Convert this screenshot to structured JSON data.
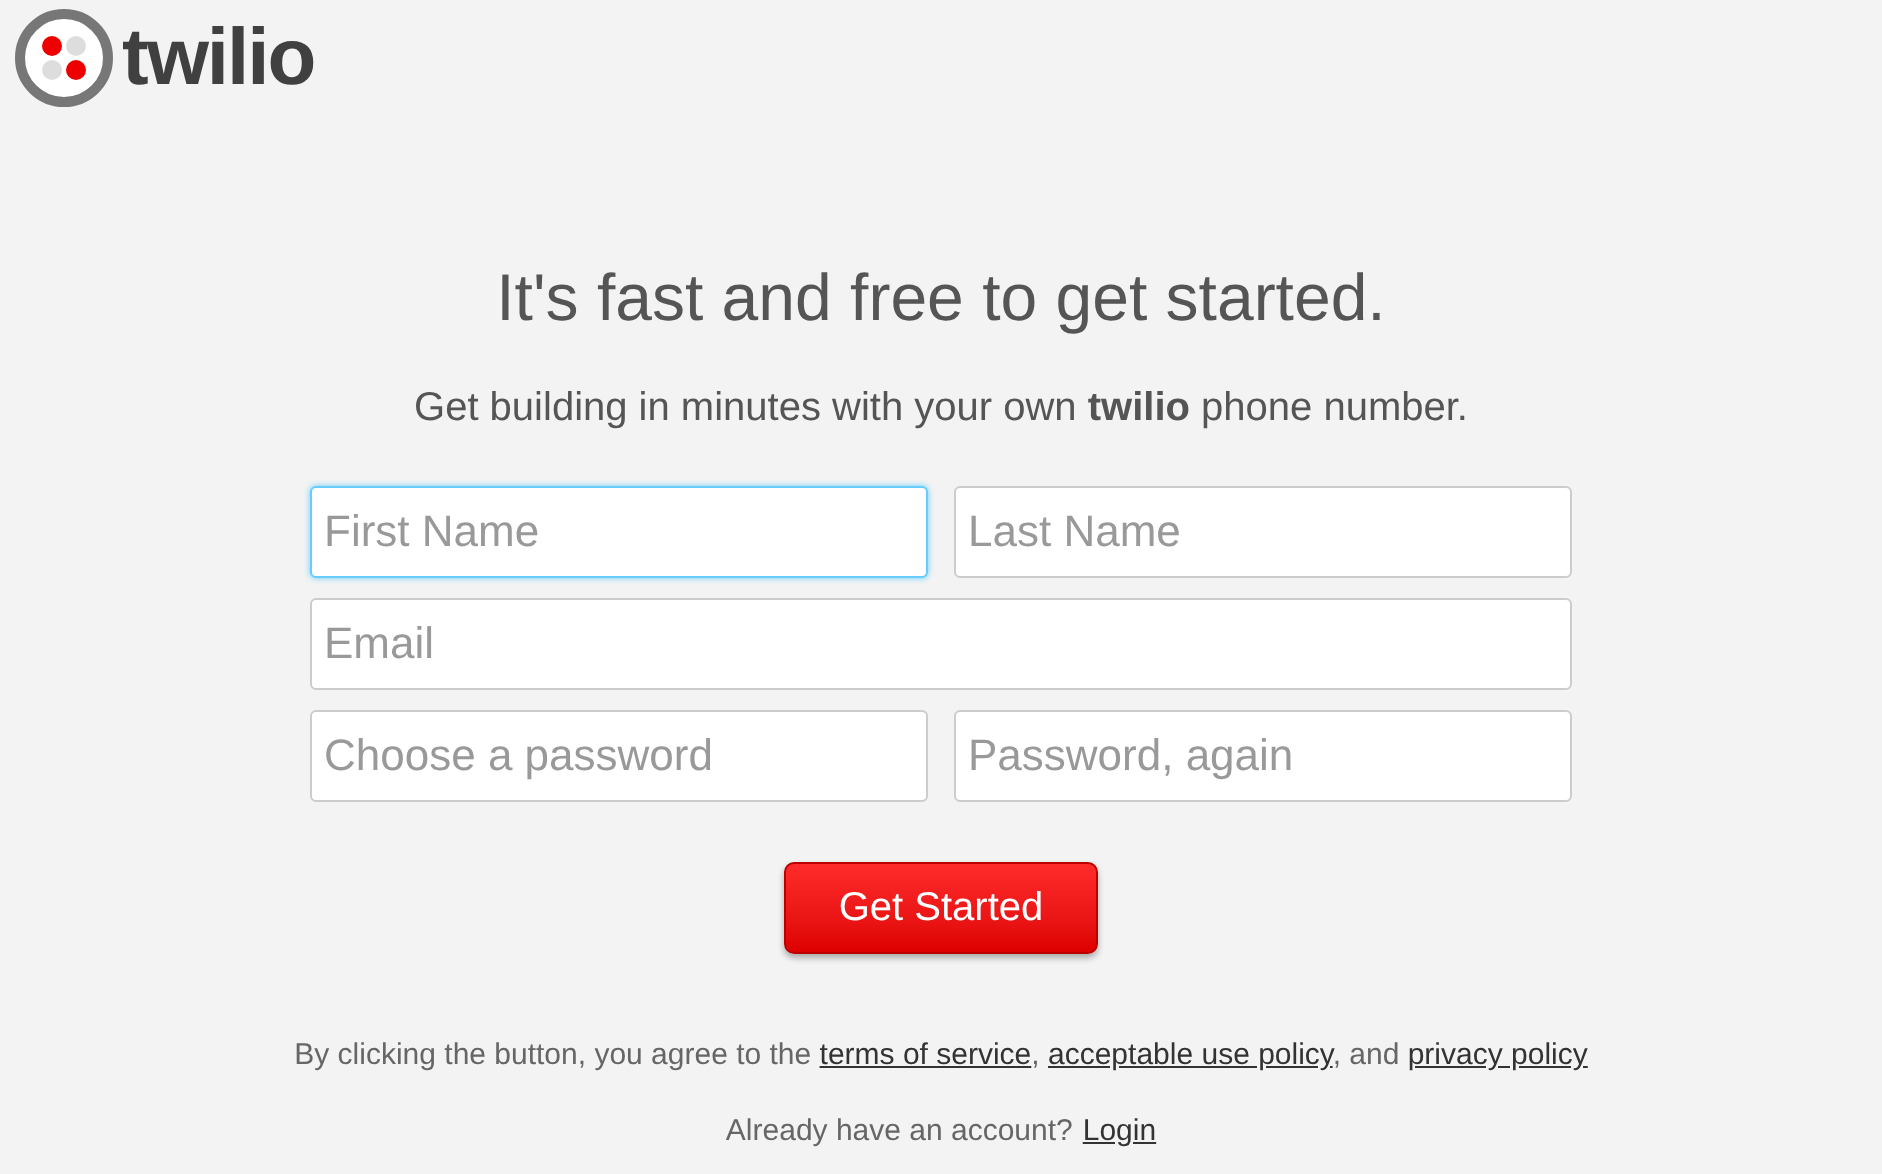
{
  "logo": {
    "text": "twilio"
  },
  "heading": "It's fast and free to get started.",
  "subheading": "Get building in minutes with your own **twilio** phone number.",
  "form_rows": [
    {
      "fields": [
        {
          "placeholder": "First Name",
          "focused": true
        },
        {
          "placeholder": "Last Name",
          "focused": false
        }
      ]
    },
    {
      "fields": [
        {
          "placeholder": "Email",
          "focused": false
        }
      ]
    },
    {
      "fields": [
        {
          "placeholder": "Choose a password",
          "focused": false
        },
        {
          "placeholder": "Password, again",
          "focused": false
        }
      ]
    }
  ],
  "submit_button": "Get Started",
  "terms": [
    {
      "kind": "text",
      "text": "By clicking the button, you agree to the "
    },
    {
      "kind": "link",
      "text": "terms of service"
    },
    {
      "kind": "text",
      "text": ", "
    },
    {
      "kind": "link",
      "text": "acceptable use policy"
    },
    {
      "kind": "text",
      "text": ", and "
    },
    {
      "kind": "link",
      "text": "privacy policy"
    }
  ],
  "login_prompt": {
    "text": "Already have an account?",
    "link": "Login"
  }
}
